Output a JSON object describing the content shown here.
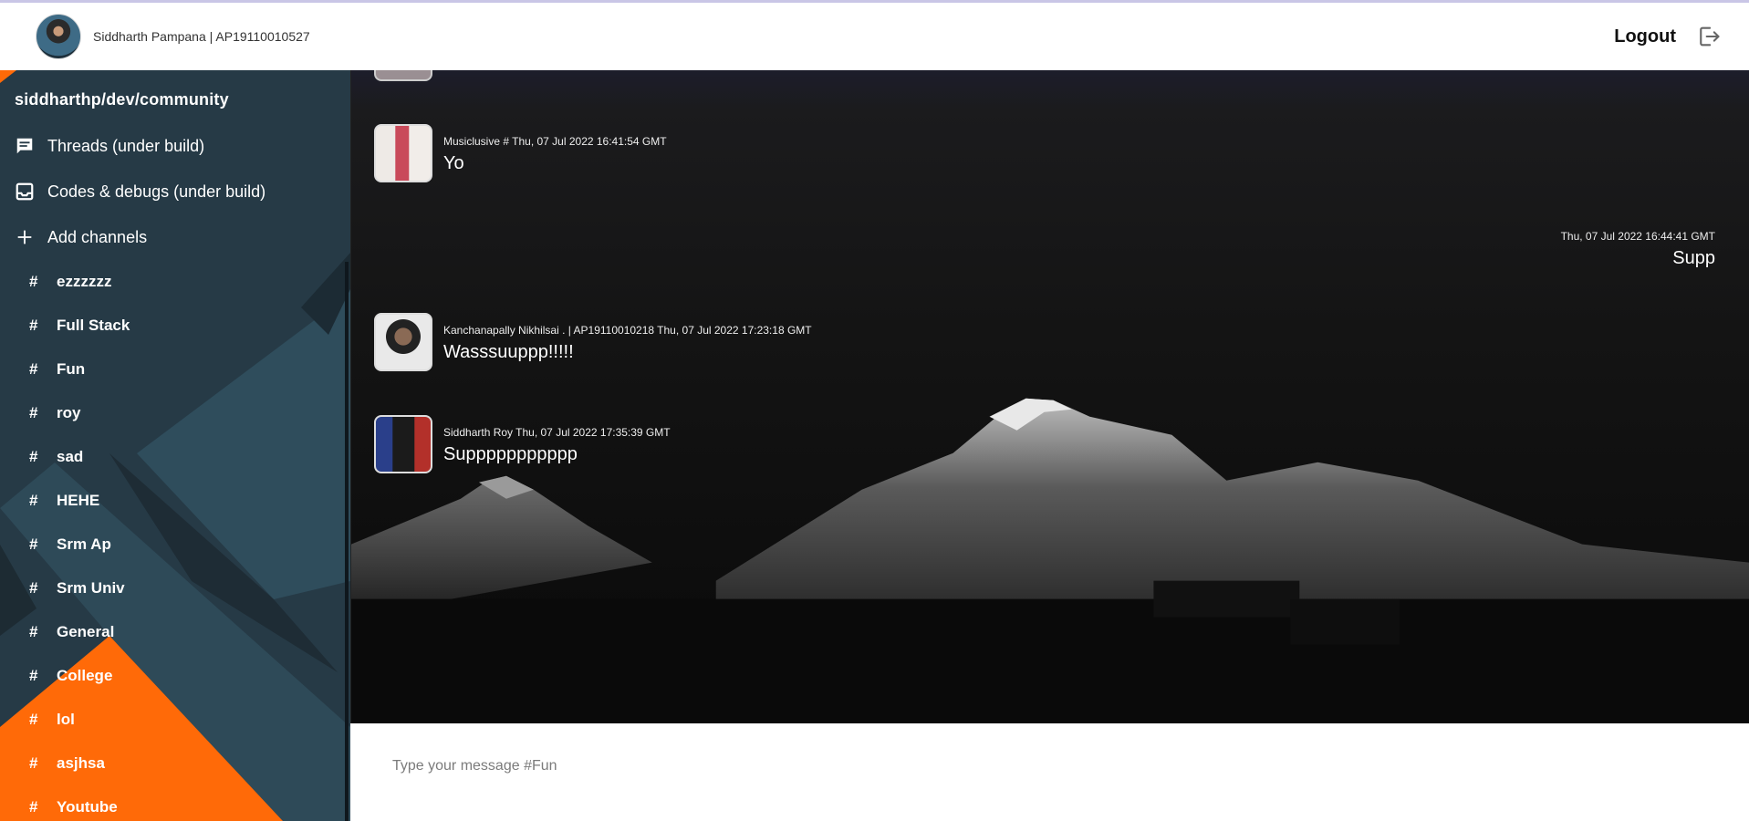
{
  "header": {
    "user_name": "Siddharth Pampana | AP19110010527",
    "logout_label": "Logout"
  },
  "sidebar": {
    "brand": "siddharthp/dev/community",
    "nav": [
      {
        "label": "Threads (under build)",
        "icon": "chat-icon"
      },
      {
        "label": "Codes & debugs (under build)",
        "icon": "inbox-icon"
      },
      {
        "label": "Add channels",
        "icon": "plus-icon"
      }
    ],
    "channel_prefix": "#",
    "channels": [
      "ezzzzzz",
      "Full Stack",
      "Fun",
      "roy",
      "sad",
      "HEHE",
      "Srm Ap",
      "Srm Univ",
      "General",
      "College",
      "lol",
      "asjhsa",
      "Youtube"
    ]
  },
  "messages": [
    {
      "meta": "Musiclusive # Thu, 07 Jul 2022 16:41:54 GMT",
      "text": "Yo",
      "own": false
    },
    {
      "meta": "Thu, 07 Jul 2022 16:44:41 GMT",
      "text": "Supp",
      "own": true
    },
    {
      "meta": "Kanchanapally Nikhilsai . | AP19110010218 Thu, 07 Jul 2022 17:23:18 GMT",
      "text": "Wasssuuppp!!!!!",
      "own": false
    },
    {
      "meta": "Siddharth Roy Thu, 07 Jul 2022 17:35:39 GMT",
      "text": "Suppppppppppp",
      "own": false
    }
  ],
  "composer": {
    "placeholder": "Type your message #Fun"
  },
  "colors": {
    "sidebar_dark": "#253844",
    "sidebar_mid": "#2f4a57",
    "accent_orange": "#ff6a08",
    "header_border": "#c9c6e6"
  }
}
